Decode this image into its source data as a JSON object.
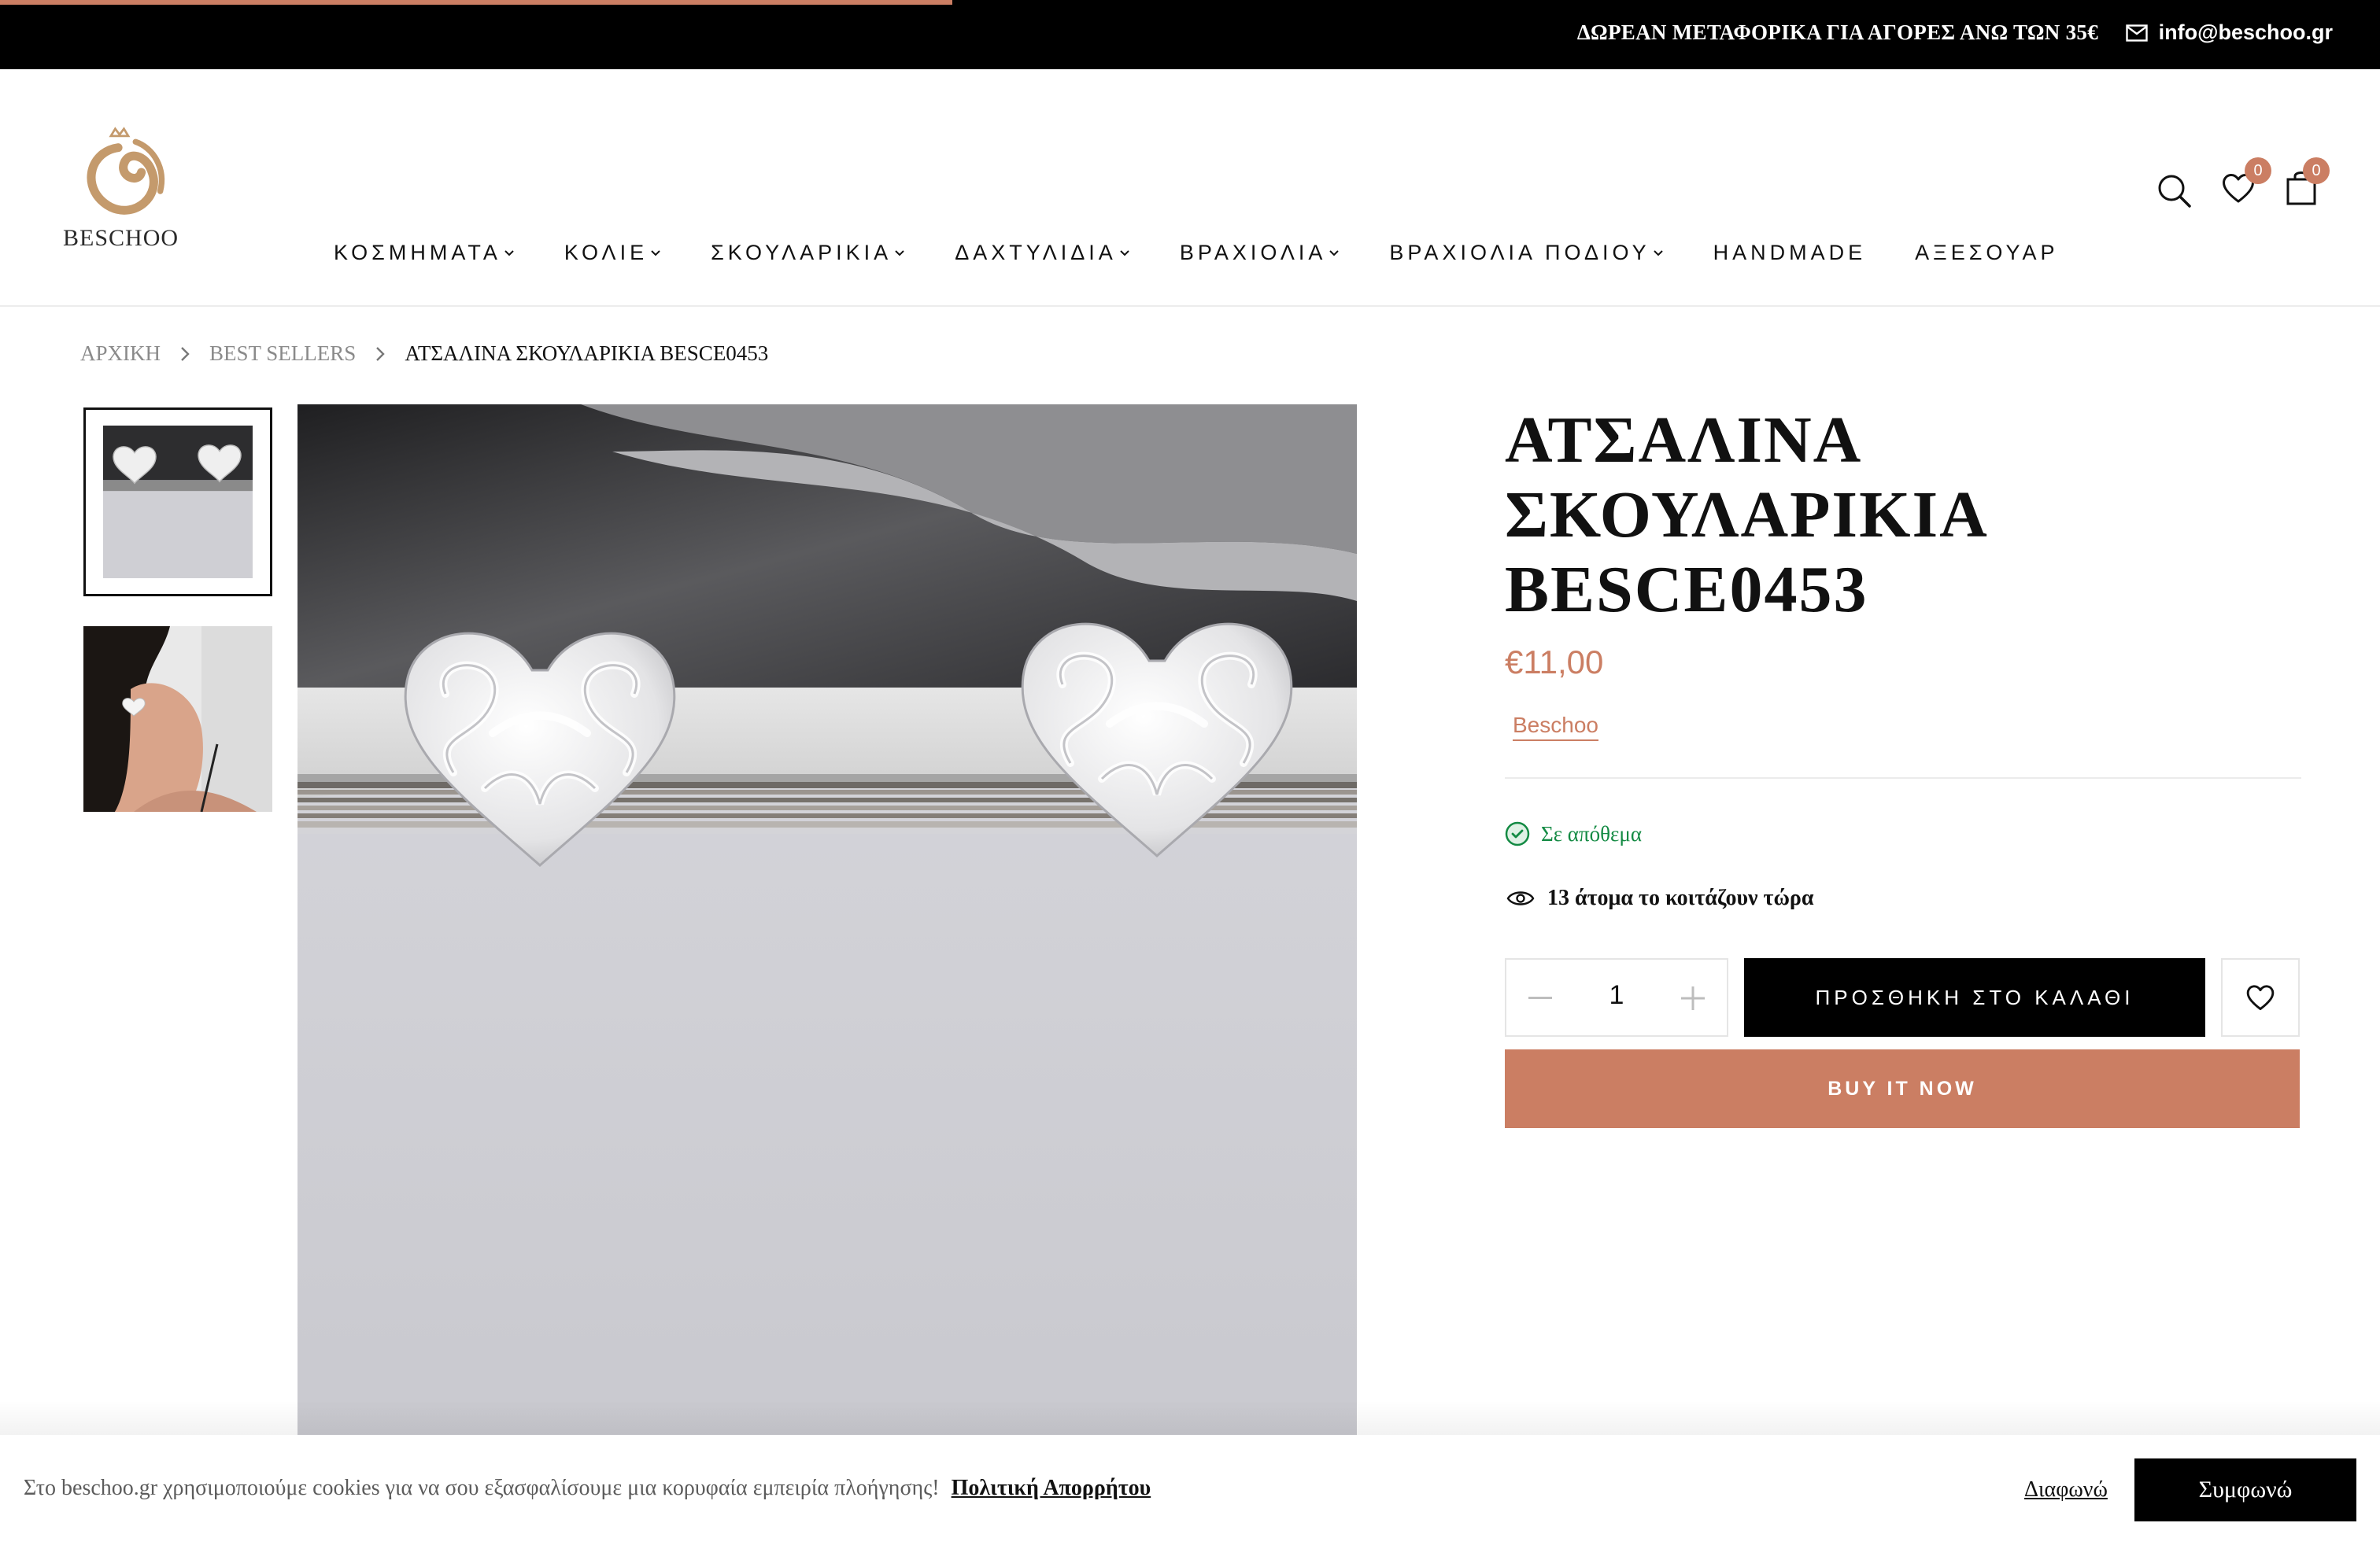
{
  "topbar": {
    "promo": "ΔΩΡΕΑΝ ΜΕΤΑΦΟΡΙΚΑ ΓΙΑ ΑΓΟΡΕΣ ΑΝΩ ΤΩΝ 35€",
    "email": "info@beschoo.gr",
    "accent_color": "#cb7e63"
  },
  "header": {
    "logo_text": "BESCHOO",
    "nav": [
      {
        "label": "ΚΟΣΜΗΜΑΤΑ",
        "dropdown": true
      },
      {
        "label": "ΚΟΛΙΕ",
        "dropdown": true
      },
      {
        "label": "ΣΚΟΥΛΑΡΙΚΙΑ",
        "dropdown": true
      },
      {
        "label": "ΔΑΧΤΥΛΙΔΙΑ",
        "dropdown": true
      },
      {
        "label": "ΒΡΑΧΙΟΛΙΑ",
        "dropdown": true
      },
      {
        "label": "ΒΡΑΧΙΟΛΙΑ ΠΟΔΙΟΥ",
        "dropdown": true
      },
      {
        "label": "HANDMADE",
        "dropdown": false
      },
      {
        "label": "ΑΞΕΣΟΥΑΡ",
        "dropdown": false
      }
    ],
    "wishlist_count": "0",
    "cart_count": "0",
    "icons": [
      "search-icon",
      "heart-icon",
      "bag-icon"
    ]
  },
  "breadcrumb": {
    "home": "ΑΡΧΙΚΗ",
    "category": "BEST SELLERS",
    "current": "ΑΤΣΑΛΙΝΑ ΣΚΟΥΛΑΡΙΚΙΑ BESCE0453"
  },
  "product": {
    "title_line1": "ΑΤΣΑΛΙΝΑ",
    "title_line2": "ΣΚΟΥΛΑΡΙΚΙΑ",
    "title_line3": "BESCE0453",
    "price": "€11,00",
    "vendor": "Beschoo",
    "stock": "Σε απόθεμα",
    "viewing": "13 άτομα το κοιτάζουν τώρα",
    "quantity": "1",
    "add_to_cart": "ΠΡΟΣΘΗΚΗ ΣΤΟ ΚΑΛΑΘΙ",
    "buy_now": "BUY IT NOW",
    "price_color": "#cb7e63",
    "stock_color": "#138a43"
  },
  "cookie": {
    "message": "Στο beschoo.gr χρησιμοποιούμε cookies για να σου εξασφαλίσουμε μια κορυφαία εμπειρία πλοήγησης!",
    "policy_link": "Πολιτική Απορρήτου",
    "decline": "Διαφωνώ",
    "accept": "Συμφωνώ"
  }
}
